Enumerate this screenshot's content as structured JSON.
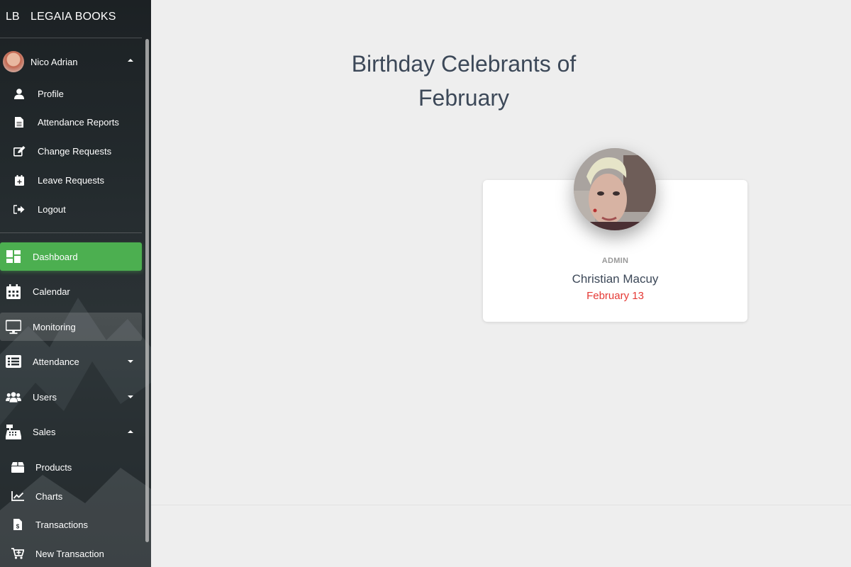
{
  "brand": {
    "mini": "LB",
    "full": "LEGAIA BOOKS"
  },
  "user": {
    "name": "Nico Adrian",
    "menu": [
      {
        "label": "Profile",
        "icon": "user-icon"
      },
      {
        "label": "Attendance Reports",
        "icon": "file-icon"
      },
      {
        "label": "Change Requests",
        "icon": "edit-icon"
      },
      {
        "label": "Leave Requests",
        "icon": "calendar-plus-icon"
      },
      {
        "label": "Logout",
        "icon": "logout-icon"
      }
    ]
  },
  "nav": {
    "items": [
      {
        "label": "Dashboard",
        "icon": "dashboard-icon",
        "active": true
      },
      {
        "label": "Calendar",
        "icon": "calendar-icon"
      },
      {
        "label": "Monitoring",
        "icon": "monitor-icon"
      },
      {
        "label": "Attendance",
        "icon": "list-icon"
      },
      {
        "label": "Users",
        "icon": "users-icon"
      },
      {
        "label": "Sales",
        "icon": "cash-register-icon"
      }
    ],
    "sales_sub": [
      {
        "label": "Products",
        "icon": "box-icon"
      },
      {
        "label": "Charts",
        "icon": "chart-icon"
      },
      {
        "label": "Transactions",
        "icon": "invoice-icon"
      },
      {
        "label": "New Transaction",
        "icon": "cart-plus-icon"
      }
    ]
  },
  "main": {
    "title_line1": "Birthday Celebrants of",
    "month": "February",
    "celebrant": {
      "role": "ADMIN",
      "name": "Christian Macuy",
      "date": "February 13"
    }
  },
  "colors": {
    "accent": "#4caf50",
    "date": "#e53935",
    "title": "#3c4858"
  }
}
